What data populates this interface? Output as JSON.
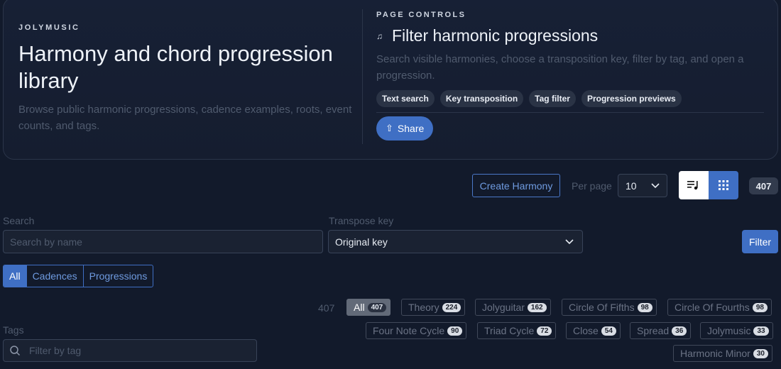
{
  "hero": {
    "brand": "JOLYMUSIC",
    "title": "Harmony and chord progression library",
    "description": "Browse public harmonic progressions, cadence examples, roots, event counts, and tags."
  },
  "page_controls": {
    "label": "PAGE CONTROLS",
    "icon": "music-note-icon",
    "title": "Filter harmonic progressions",
    "description": "Search visible harmonies, choose a transposition key, filter by tag, and open a progression.",
    "chips": [
      "Text search",
      "Key transposition",
      "Tag filter",
      "Progression previews"
    ],
    "share_label": "Share"
  },
  "toolbar": {
    "create_label": "Create Harmony",
    "per_page_label": "Per page",
    "per_page_value": "10",
    "total_count": "407"
  },
  "search": {
    "label": "Search",
    "placeholder": "Search by name"
  },
  "transpose": {
    "label": "Transpose key",
    "value": "Original key"
  },
  "filter_label": "Filter",
  "segments": [
    "All",
    "Cadences",
    "Progressions"
  ],
  "tags": {
    "label": "Tags",
    "total": "407",
    "filter_placeholder": "Filter by tag",
    "items": [
      {
        "name": "All",
        "count": "407"
      },
      {
        "name": "Theory",
        "count": "224"
      },
      {
        "name": "Jolyguitar",
        "count": "162"
      },
      {
        "name": "Circle Of Fifths",
        "count": "98"
      },
      {
        "name": "Circle Of Fourths",
        "count": "98"
      },
      {
        "name": "Four Note Cycle",
        "count": "90"
      },
      {
        "name": "Triad Cycle",
        "count": "72"
      },
      {
        "name": "Close",
        "count": "54"
      },
      {
        "name": "Spread",
        "count": "36"
      },
      {
        "name": "Jolymusic",
        "count": "33"
      },
      {
        "name": "Harmonic Minor",
        "count": "30"
      }
    ]
  }
}
